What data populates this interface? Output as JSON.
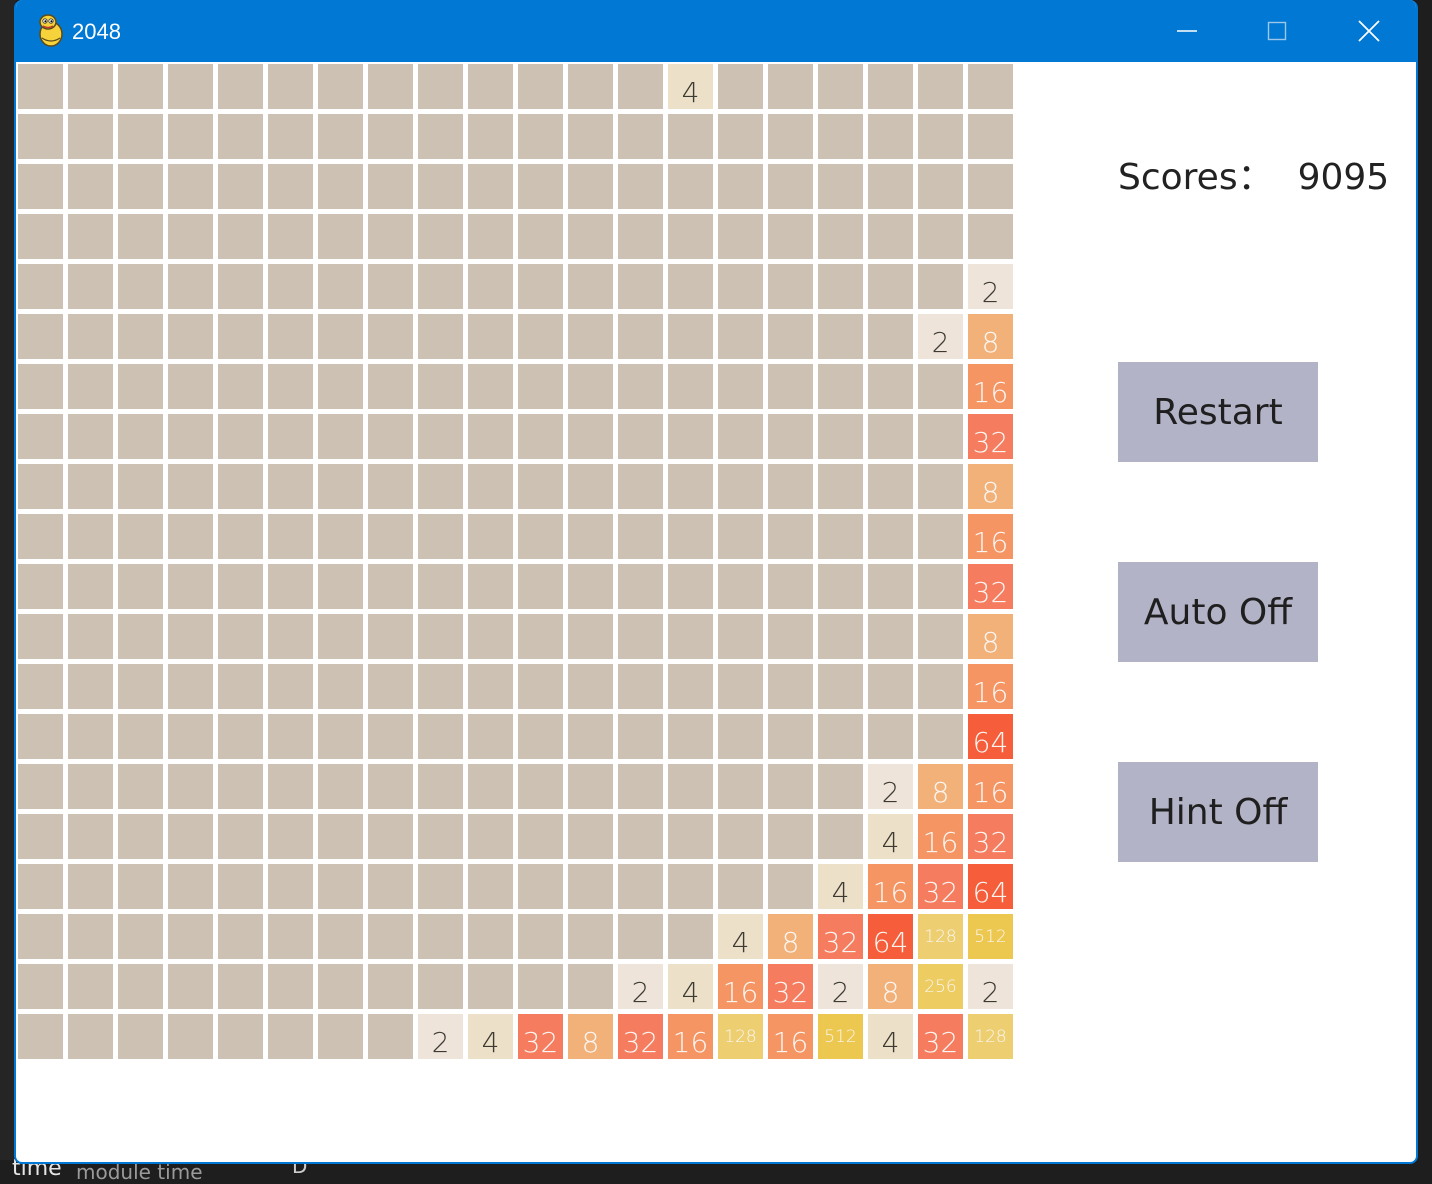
{
  "window": {
    "title": "2048",
    "controls": {
      "minimize": "minimize",
      "maximize": "maximize",
      "close": "close"
    }
  },
  "side": {
    "score_label": "Scores：",
    "score_value": "9095",
    "restart_label": "Restart",
    "auto_label": "Auto Off",
    "hint_label": "Hint Off"
  },
  "background": {
    "bottom_word": "time",
    "bottom_desc": "module time",
    "bottom_char": "D"
  },
  "board": {
    "size": 20,
    "rows": [
      [
        0,
        0,
        0,
        0,
        0,
        0,
        0,
        0,
        0,
        0,
        0,
        0,
        0,
        4,
        0,
        0,
        0,
        0,
        0,
        0
      ],
      [
        0,
        0,
        0,
        0,
        0,
        0,
        0,
        0,
        0,
        0,
        0,
        0,
        0,
        0,
        0,
        0,
        0,
        0,
        0,
        0
      ],
      [
        0,
        0,
        0,
        0,
        0,
        0,
        0,
        0,
        0,
        0,
        0,
        0,
        0,
        0,
        0,
        0,
        0,
        0,
        0,
        0
      ],
      [
        0,
        0,
        0,
        0,
        0,
        0,
        0,
        0,
        0,
        0,
        0,
        0,
        0,
        0,
        0,
        0,
        0,
        0,
        0,
        0
      ],
      [
        0,
        0,
        0,
        0,
        0,
        0,
        0,
        0,
        0,
        0,
        0,
        0,
        0,
        0,
        0,
        0,
        0,
        0,
        0,
        2
      ],
      [
        0,
        0,
        0,
        0,
        0,
        0,
        0,
        0,
        0,
        0,
        0,
        0,
        0,
        0,
        0,
        0,
        0,
        0,
        2,
        8
      ],
      [
        0,
        0,
        0,
        0,
        0,
        0,
        0,
        0,
        0,
        0,
        0,
        0,
        0,
        0,
        0,
        0,
        0,
        0,
        0,
        16
      ],
      [
        0,
        0,
        0,
        0,
        0,
        0,
        0,
        0,
        0,
        0,
        0,
        0,
        0,
        0,
        0,
        0,
        0,
        0,
        0,
        32
      ],
      [
        0,
        0,
        0,
        0,
        0,
        0,
        0,
        0,
        0,
        0,
        0,
        0,
        0,
        0,
        0,
        0,
        0,
        0,
        0,
        8
      ],
      [
        0,
        0,
        0,
        0,
        0,
        0,
        0,
        0,
        0,
        0,
        0,
        0,
        0,
        0,
        0,
        0,
        0,
        0,
        0,
        16
      ],
      [
        0,
        0,
        0,
        0,
        0,
        0,
        0,
        0,
        0,
        0,
        0,
        0,
        0,
        0,
        0,
        0,
        0,
        0,
        0,
        32
      ],
      [
        0,
        0,
        0,
        0,
        0,
        0,
        0,
        0,
        0,
        0,
        0,
        0,
        0,
        0,
        0,
        0,
        0,
        0,
        0,
        8
      ],
      [
        0,
        0,
        0,
        0,
        0,
        0,
        0,
        0,
        0,
        0,
        0,
        0,
        0,
        0,
        0,
        0,
        0,
        0,
        0,
        16
      ],
      [
        0,
        0,
        0,
        0,
        0,
        0,
        0,
        0,
        0,
        0,
        0,
        0,
        0,
        0,
        0,
        0,
        0,
        0,
        0,
        64
      ],
      [
        0,
        0,
        0,
        0,
        0,
        0,
        0,
        0,
        0,
        0,
        0,
        0,
        0,
        0,
        0,
        0,
        0,
        2,
        8,
        16
      ],
      [
        0,
        0,
        0,
        0,
        0,
        0,
        0,
        0,
        0,
        0,
        0,
        0,
        0,
        0,
        0,
        0,
        0,
        4,
        16,
        32
      ],
      [
        0,
        0,
        0,
        0,
        0,
        0,
        0,
        0,
        0,
        0,
        0,
        0,
        0,
        0,
        0,
        0,
        4,
        16,
        32,
        64
      ],
      [
        0,
        0,
        0,
        0,
        0,
        0,
        0,
        0,
        0,
        0,
        0,
        0,
        0,
        0,
        4,
        8,
        32,
        64,
        128,
        512
      ],
      [
        0,
        0,
        0,
        0,
        0,
        0,
        0,
        0,
        0,
        0,
        0,
        0,
        2,
        4,
        16,
        32,
        2,
        8,
        256,
        2
      ],
      [
        0,
        0,
        0,
        0,
        0,
        0,
        0,
        0,
        2,
        4,
        32,
        8,
        32,
        16,
        128,
        16,
        512,
        4,
        32,
        128
      ]
    ]
  },
  "tile_colors": {
    "0": {
      "bg": "#cdc1b4",
      "fg": "#776e65"
    },
    "2": {
      "bg": "#eee4da",
      "fg": "#3c3a32"
    },
    "4": {
      "bg": "#ede0c8",
      "fg": "#3c3a32"
    },
    "8": {
      "bg": "#f2b179",
      "fg": "#f9f6f2"
    },
    "16": {
      "bg": "#f59563",
      "fg": "#f9f6f2"
    },
    "32": {
      "bg": "#f67c5f",
      "fg": "#f9f6f2"
    },
    "64": {
      "bg": "#f65e3b",
      "fg": "#f9f6f2"
    },
    "128": {
      "bg": "#edcf72",
      "fg": "#f9f6f2"
    },
    "256": {
      "bg": "#edcc61",
      "fg": "#f9f6f2"
    },
    "512": {
      "bg": "#edc850",
      "fg": "#f9f6f2"
    }
  },
  "colors": {
    "titlebar": "#0078d4",
    "button_bg": "#b3b3c8",
    "empty_tile": "#cdc1b4"
  }
}
